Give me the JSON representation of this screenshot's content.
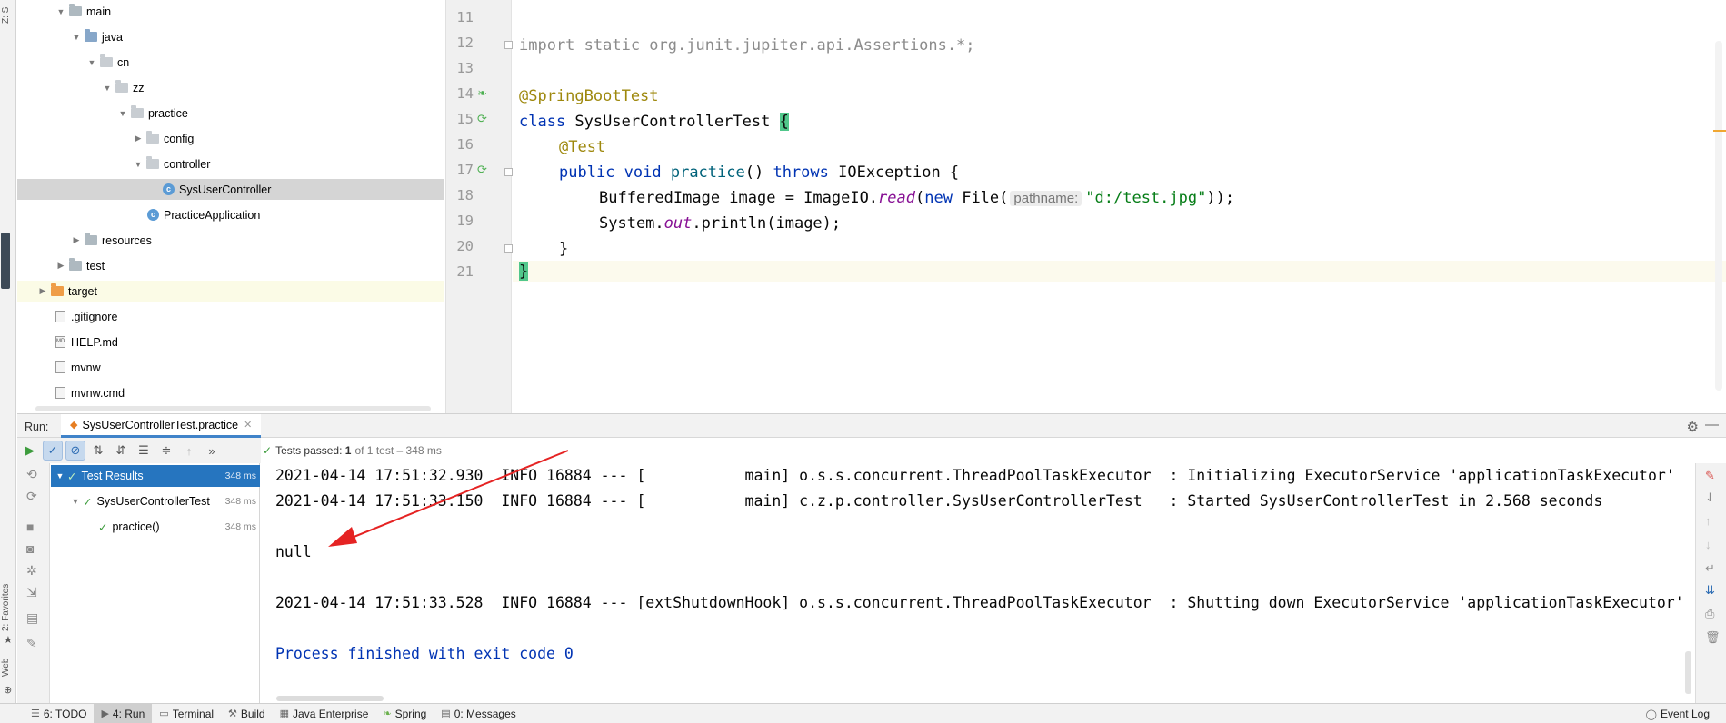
{
  "side_tabs": {
    "structure": "Z: S",
    "favorites": "2: Favorites",
    "web": "Web"
  },
  "project_tree": {
    "items": [
      {
        "label": "main",
        "icon": "folder-icon",
        "expanded": true
      },
      {
        "label": "java",
        "icon": "source-folder-icon",
        "expanded": true
      },
      {
        "label": "cn",
        "icon": "package-icon",
        "expanded": true
      },
      {
        "label": "zz",
        "icon": "package-icon",
        "expanded": true
      },
      {
        "label": "practice",
        "icon": "package-icon",
        "expanded": true
      },
      {
        "label": "config",
        "icon": "package-icon",
        "expanded": false
      },
      {
        "label": "controller",
        "icon": "package-icon",
        "expanded": true
      },
      {
        "label": "SysUserController",
        "icon": "class-icon",
        "selected": true
      },
      {
        "label": "PracticeApplication",
        "icon": "class-icon"
      },
      {
        "label": "resources",
        "icon": "folder-icon",
        "expanded": false
      },
      {
        "label": "test",
        "icon": "folder-icon",
        "expanded": false
      },
      {
        "label": "target",
        "icon": "excluded-folder-icon",
        "expanded": false
      },
      {
        "label": ".gitignore",
        "icon": "file-icon"
      },
      {
        "label": "HELP.md",
        "icon": "markdown-file-icon"
      },
      {
        "label": "mvnw",
        "icon": "file-icon"
      },
      {
        "label": "mvnw.cmd",
        "icon": "file-icon"
      }
    ]
  },
  "editor": {
    "line_numbers": [
      "11",
      "12",
      "13",
      "14",
      "15",
      "16",
      "17",
      "18",
      "19",
      "20",
      "21"
    ],
    "lines": {
      "l12_import": "import static ",
      "l12_rest": "org.junit.jupiter.api.Assertions.*;",
      "l14_annotation": "@SpringBootTest",
      "l15_kw": "class ",
      "l15_name": "SysUserControllerTest ",
      "l15_brace": "{",
      "l16_annotation": "@Test",
      "l17_kw1": "public ",
      "l17_kw2": "void ",
      "l17_name": "practice",
      "l17_mid": "() ",
      "l17_throws": "throws ",
      "l17_rest": "IOException {",
      "l18_a": "BufferedImage image = ImageIO.",
      "l18_read": "read",
      "l18_b": "(",
      "l18_new": "new ",
      "l18_c": "File(",
      "l18_hint": "pathname:",
      "l18_str": "\"d:/test.jpg\"",
      "l18_d": "));",
      "l19_a": "System.",
      "l19_out": "out",
      "l19_b": ".println(image);",
      "l20": "}",
      "l21": "}"
    }
  },
  "run_window": {
    "label": "Run:",
    "tab_title": "SysUserControllerTest.practice",
    "status_prefix": "Tests passed:",
    "status_count": "1",
    "status_suffix": "of 1 test – 348 ms",
    "test_tree": [
      {
        "label": "Test Results",
        "time": "348 ms",
        "selected": true
      },
      {
        "label": "SysUserControllerTest",
        "time": "348 ms"
      },
      {
        "label": "practice()",
        "time": "348 ms"
      }
    ],
    "console_lines": [
      "2021-04-14 17:51:32.930  INFO 16884 --- [           main] o.s.s.concurrent.ThreadPoolTaskExecutor  : Initializing ExecutorService 'applicationTaskExecutor'",
      "2021-04-14 17:51:33.150  INFO 16884 --- [           main] c.z.p.controller.SysUserControllerTest   : Started SysUserControllerTest in 2.568 seconds",
      "",
      "null",
      "",
      "2021-04-14 17:51:33.528  INFO 16884 --- [extShutdownHook] o.s.s.concurrent.ThreadPoolTaskExecutor  : Shutting down ExecutorService 'applicationTaskExecutor'",
      "",
      "Process finished with exit code 0"
    ]
  },
  "bottom_bar": {
    "items": [
      {
        "label": "6: TODO",
        "icon": "list-icon"
      },
      {
        "label": "4: Run",
        "icon": "run-icon",
        "active": true
      },
      {
        "label": "Terminal",
        "icon": "terminal-icon"
      },
      {
        "label": "Build",
        "icon": "hammer-icon"
      },
      {
        "label": "Java Enterprise",
        "icon": "java-enterprise-icon"
      },
      {
        "label": "Spring",
        "icon": "spring-icon"
      },
      {
        "label": "0: Messages",
        "icon": "messages-icon"
      }
    ],
    "event_log": "Event Log"
  },
  "colors": {
    "selection": "#2675bf",
    "pass_green": "#3d9c3d",
    "annotation_arrow": "#e52323",
    "keyword": "#0033b3"
  }
}
